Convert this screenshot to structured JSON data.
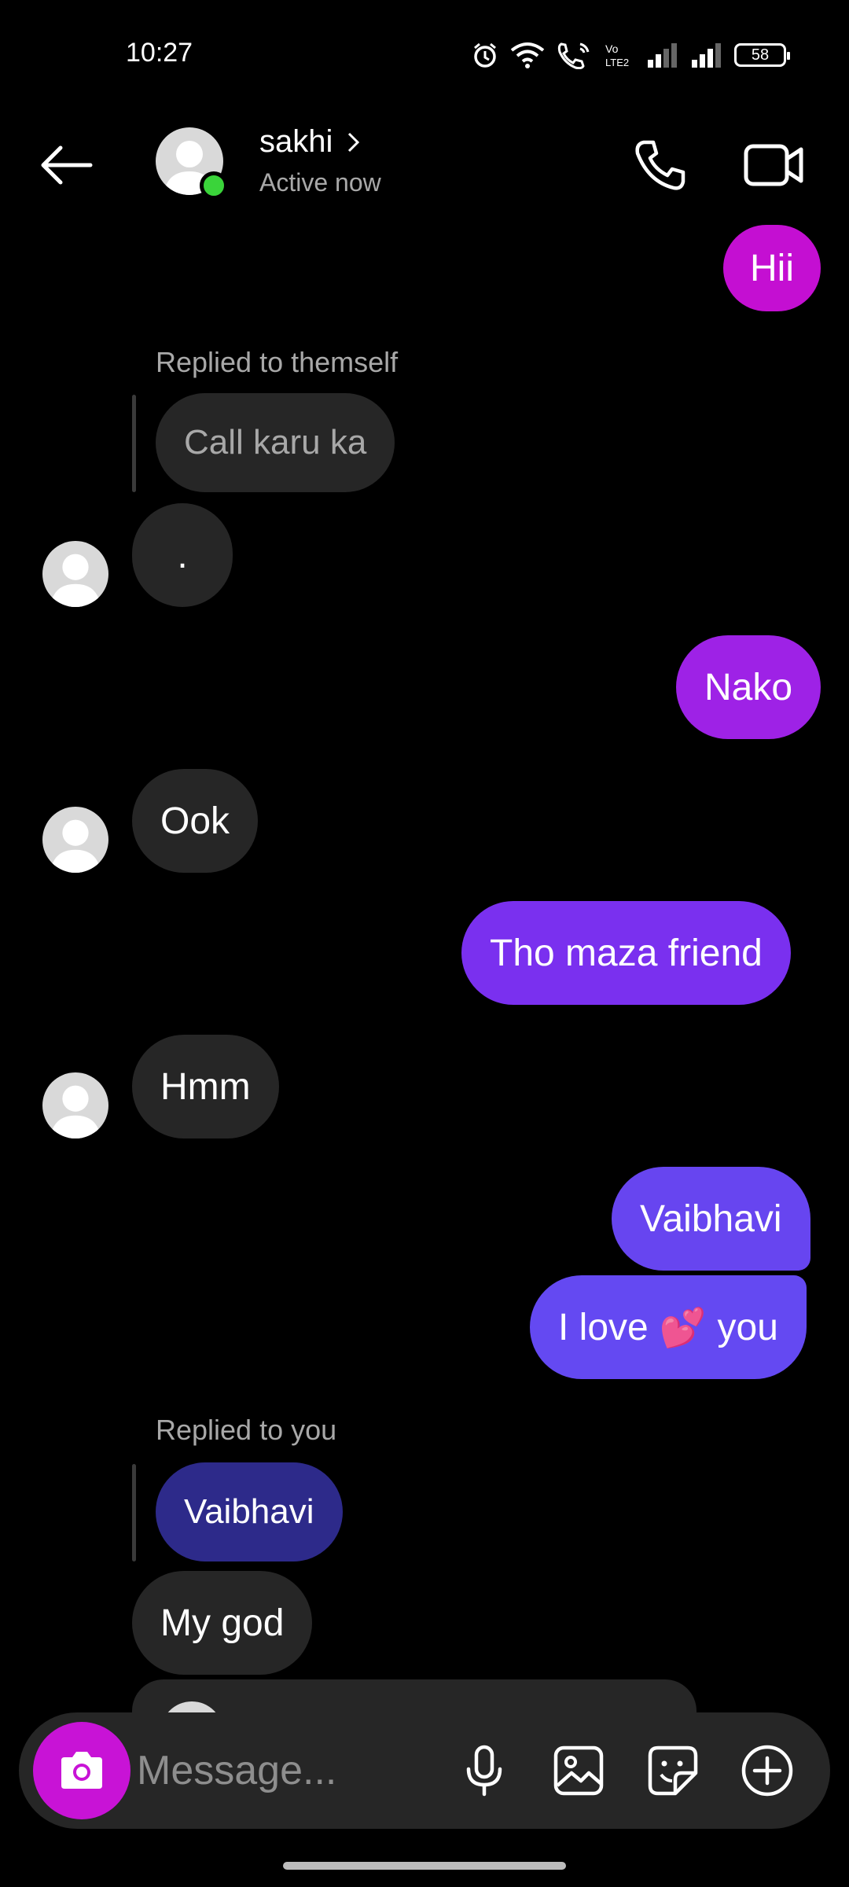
{
  "status_bar": {
    "time": "10:27",
    "battery": "58"
  },
  "header": {
    "name": "sakhi",
    "status": "Active now"
  },
  "messages": {
    "m1": "Hii",
    "reply1_caption": "Replied to themself",
    "reply1_quote": "Call karu ka",
    "m2": ".",
    "m3": "Nako",
    "m4": "Ook",
    "m5": "Tho maza friend",
    "m6": "Hmm",
    "m7": "Vaibhavi",
    "m8_part1": "I love",
    "m8_emoji": "💕",
    "m8_part2": "you",
    "reply2_caption": "Replied to you",
    "reply2_quote": "Vaibhavi",
    "m9": "My god"
  },
  "composer": {
    "placeholder": "Message..."
  },
  "colors": {
    "outgoing_gradient_top": "#c813d6",
    "outgoing_gradient_bottom": "#5b4df0",
    "incoming": "#262626",
    "online": "#3ad43a"
  },
  "icons": {
    "back": "arrow-left-icon",
    "call": "phone-icon",
    "video": "video-camera-icon",
    "camera": "camera-icon",
    "mic": "microphone-icon",
    "gallery": "image-icon",
    "sticker": "sticker-icon",
    "more": "plus-circle-icon"
  }
}
